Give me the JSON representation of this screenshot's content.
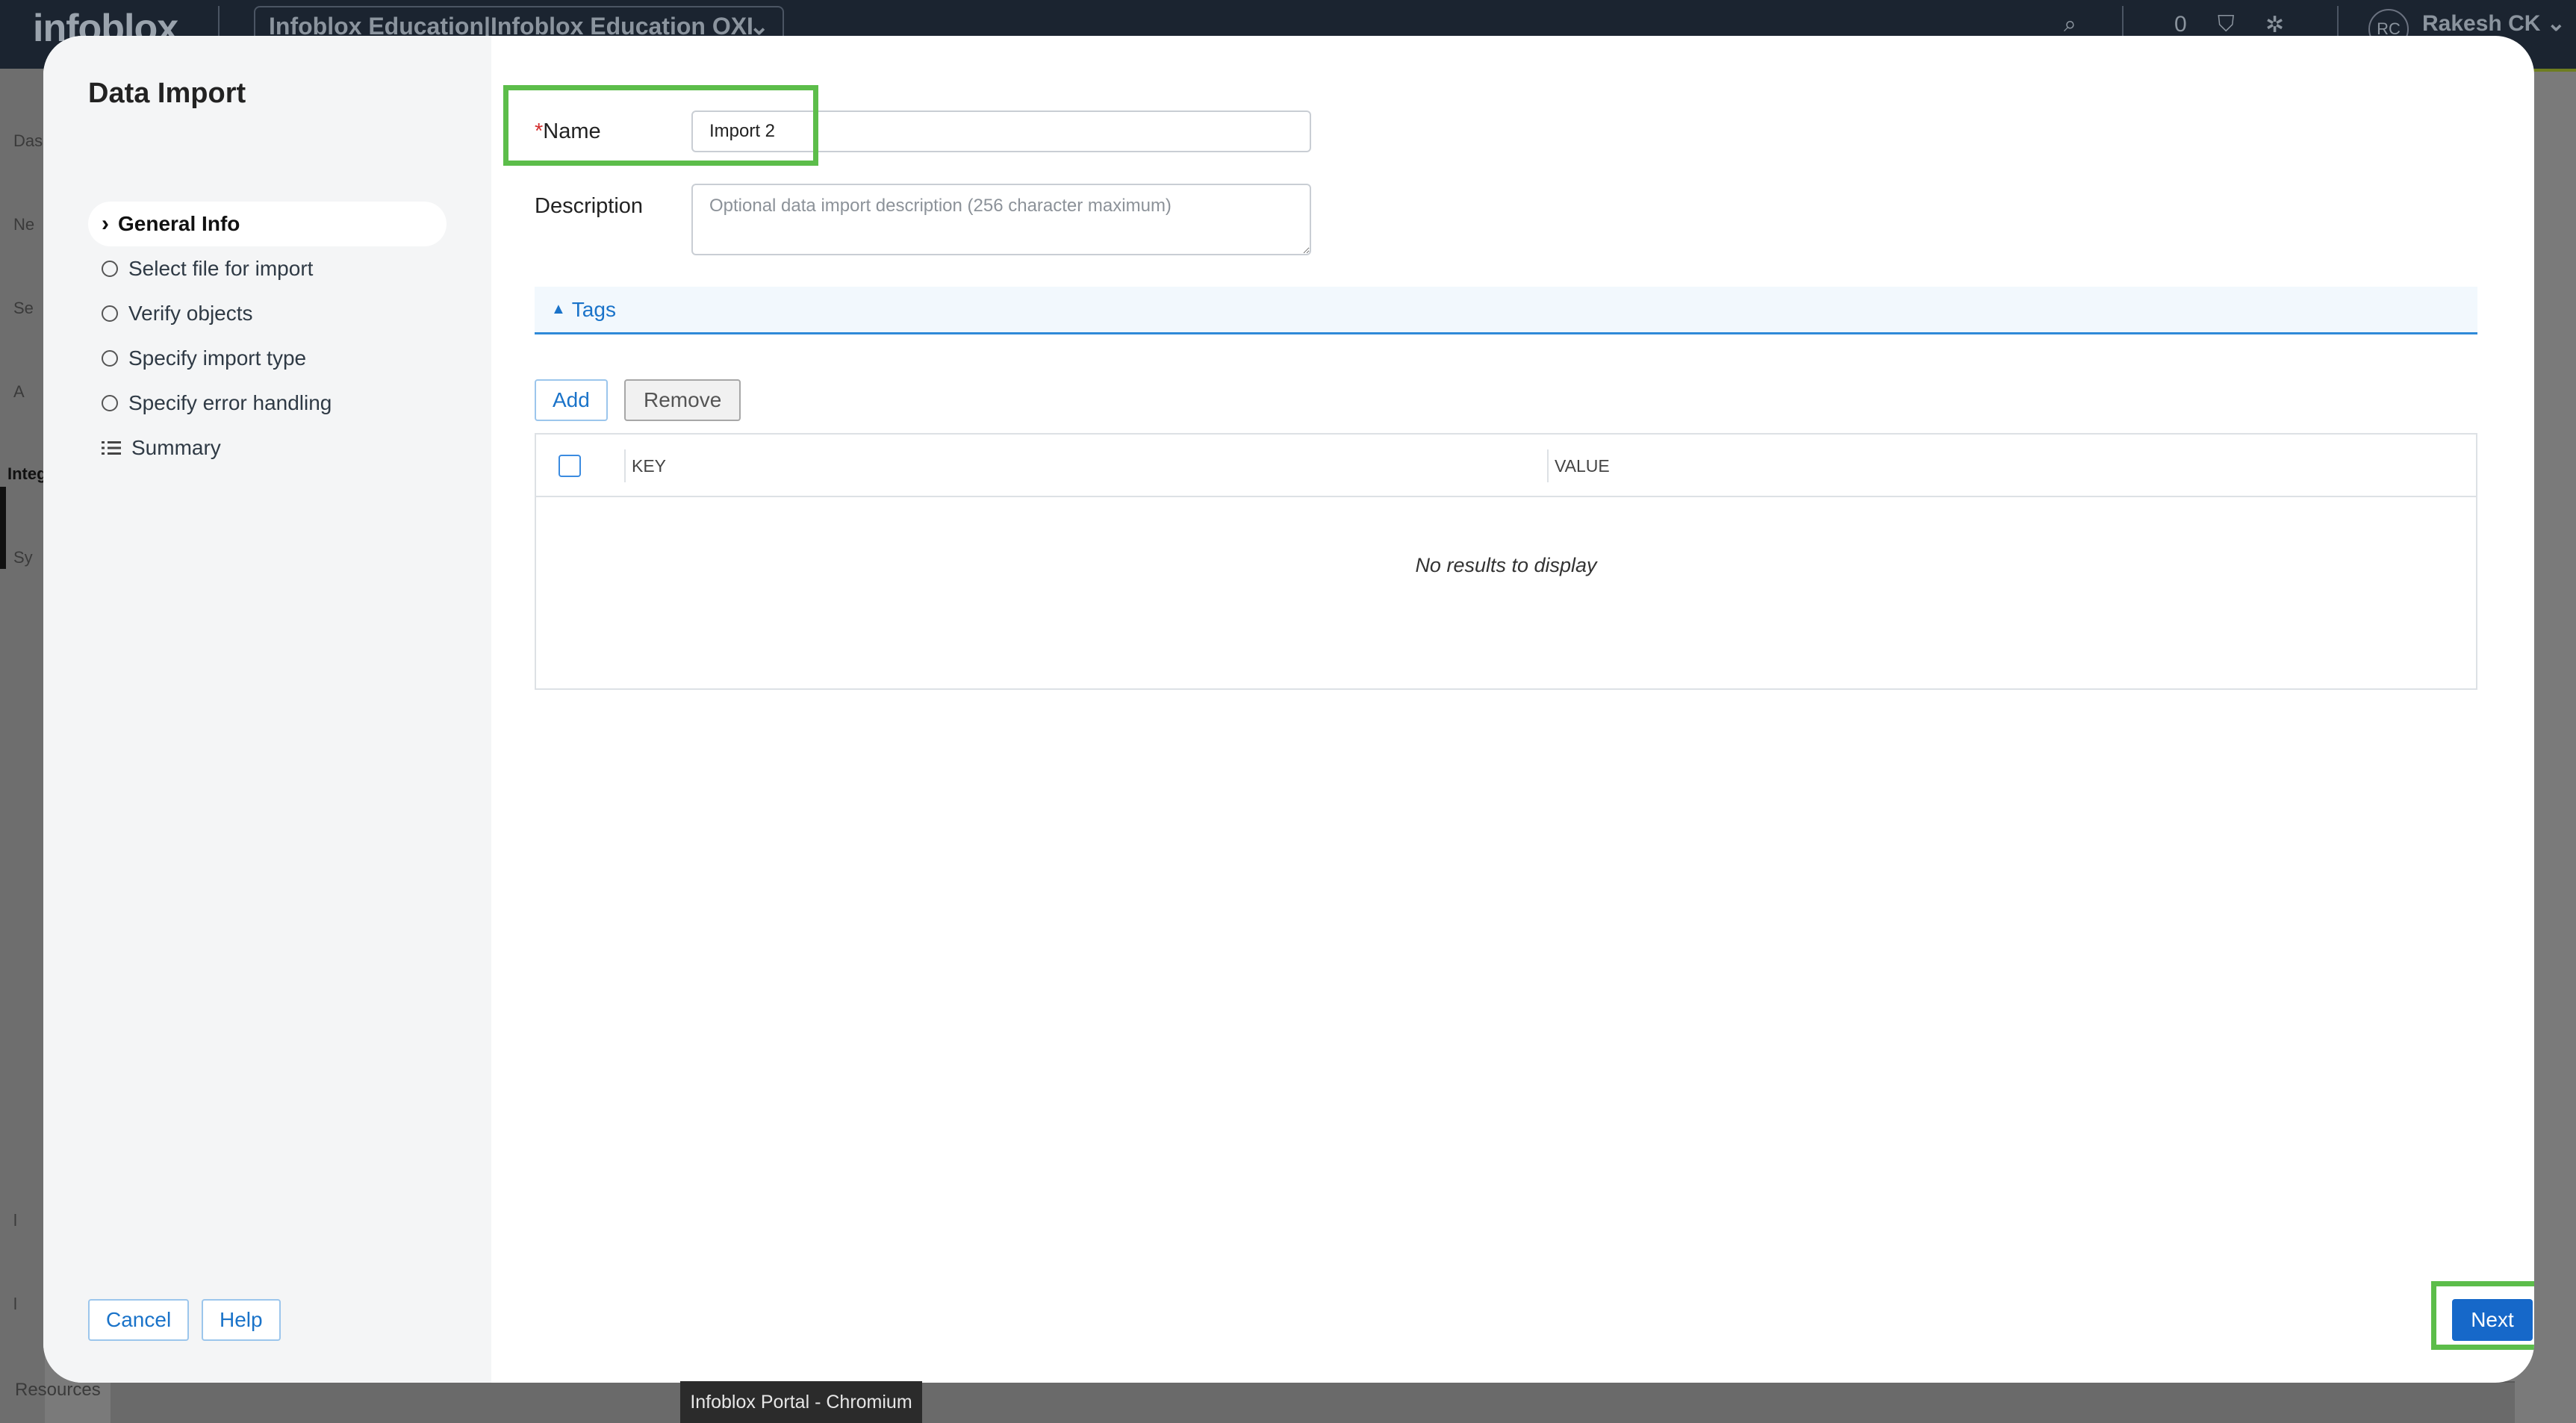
{
  "background_app": {
    "logo": "infoblox",
    "org_selector": "Infoblox Education|Infoblox Education OXI",
    "notification_count": "0",
    "user_initials": "RC",
    "user_name": "Rakesh CK",
    "nav_fragments": [
      "Das",
      "Ne",
      "Se",
      "A",
      "Integ",
      "Sy",
      "l",
      "l"
    ],
    "resources_label": "Resources"
  },
  "modal": {
    "title": "Data Import",
    "steps": [
      {
        "label": "General Info",
        "state": "active"
      },
      {
        "label": "Select file for import",
        "state": "pending"
      },
      {
        "label": "Verify objects",
        "state": "pending"
      },
      {
        "label": "Specify import type",
        "state": "pending"
      },
      {
        "label": "Specify error handling",
        "state": "pending"
      },
      {
        "label": "Summary",
        "state": "summary"
      }
    ],
    "cancel_label": "Cancel",
    "help_label": "Help",
    "next_label": "Next"
  },
  "form": {
    "name_required_mark": "*",
    "name_label": "Name",
    "name_value": "Import 2",
    "description_label": "Description",
    "description_placeholder": "Optional data import description (256 character maximum)",
    "tags_label": "Tags",
    "add_label": "Add",
    "remove_label": "Remove",
    "table": {
      "columns": [
        "KEY",
        "VALUE"
      ],
      "rows": [],
      "empty_message": "No results to display"
    }
  },
  "taskbar_tooltip": "Infoblox Portal - Chromium",
  "colors": {
    "accent_blue": "#1668c9",
    "highlight_green": "#5cbd4a",
    "required_red": "#d32f2f"
  }
}
